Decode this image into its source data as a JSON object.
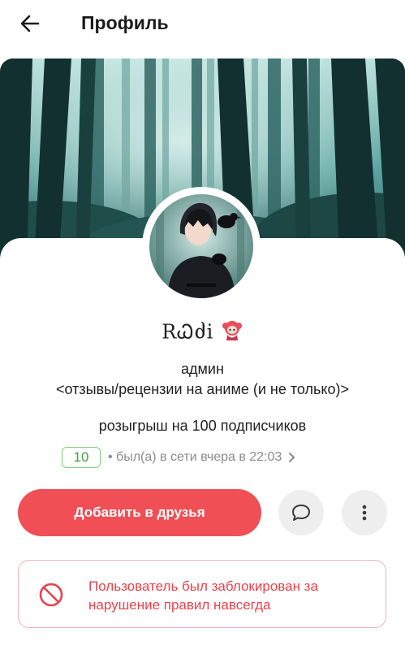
{
  "header": {
    "title": "Профиль",
    "back_icon": "arrow-left-icon"
  },
  "profile": {
    "username": "RᏇძi",
    "badge_icon": "anime-girl-sticker-icon",
    "status_line1": "админ",
    "status_line2": "<отзывы/рецензии на аниме (и не только)>",
    "giveaway_text": "розыгрыш на 100 подписчиков",
    "level": "10",
    "last_seen": "• был(а) в сети вчера в 22:03"
  },
  "actions": {
    "add_friend_label": "Добавить в друзья",
    "message_icon": "chat-bubble-icon",
    "more_icon": "more-vertical-icon"
  },
  "ban_notice": {
    "icon": "blocked-icon",
    "text": "Пользователь был заблокирован за нарушение правил навсегда"
  },
  "colors": {
    "accent": "#ef4f55",
    "level_green": "#3da63d",
    "ban_red": "#e8424a",
    "ban_border": "#f1b0b4"
  }
}
